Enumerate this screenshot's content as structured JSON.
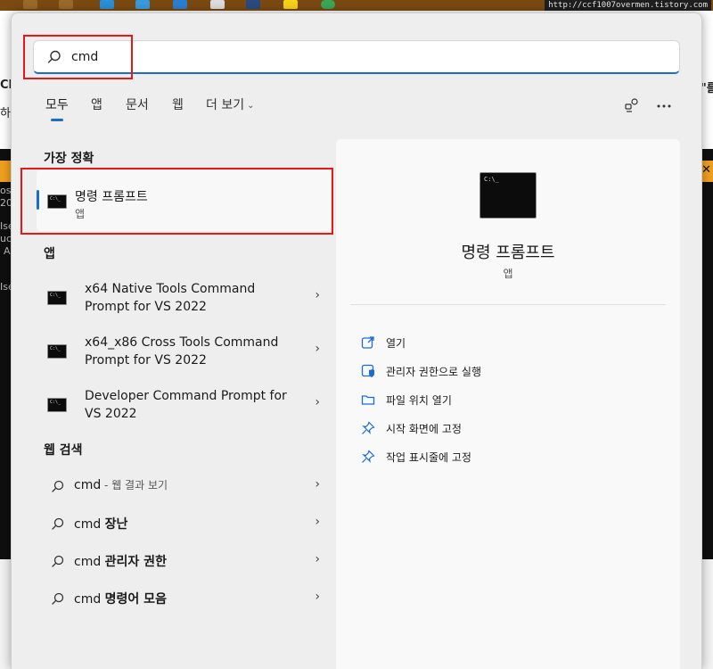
{
  "background": {
    "url_text": "http://ccf1007overmen.tistory.com",
    "left_fragments": [
      "Cl",
      "하.",
      "os",
      "20",
      "Ise",
      "uc",
      "A",
      "Ise"
    ],
    "right_fragments": [
      "\"를"
    ],
    "close_glyph": "✕"
  },
  "search": {
    "value": "cmd",
    "icon": "search-icon"
  },
  "tabs": [
    {
      "label": "모두",
      "active": true
    },
    {
      "label": "앱",
      "active": false
    },
    {
      "label": "문서",
      "active": false
    },
    {
      "label": "웹",
      "active": false
    },
    {
      "label": "더 보기",
      "active": false
    }
  ],
  "more_glyph": "⌄",
  "top_icons": [
    "share-icon",
    "more-options-icon"
  ],
  "best_match": {
    "heading": "가장 정확",
    "title": "명령 프롬프트",
    "subtitle": "앱"
  },
  "apps": {
    "heading": "앱",
    "items": [
      {
        "line1": "x64 Native Tools Command",
        "line2": "Prompt for VS 2022"
      },
      {
        "line1": "x64_x86 Cross Tools Command",
        "line2": "Prompt for VS 2022"
      },
      {
        "line1": "Developer Command Prompt for",
        "line2": "VS 2022"
      }
    ]
  },
  "web_search": {
    "heading": "웹 검색",
    "items": [
      {
        "prefix": "cmd",
        "suffix": " - 웹 결과 보기"
      },
      {
        "prefix": "cmd ",
        "suffix": "장난"
      },
      {
        "prefix": "cmd ",
        "suffix": "관리자 권한"
      },
      {
        "prefix": "cmd ",
        "suffix": "명령어 모음"
      }
    ]
  },
  "chevron": "›",
  "preview": {
    "title": "명령 프롬프트",
    "subtitle": "앱",
    "actions": [
      {
        "label": "열기",
        "icon": "open-icon"
      },
      {
        "label": "관리자 권한으로 실행",
        "icon": "admin-shield-icon"
      },
      {
        "label": "파일 위치 열기",
        "icon": "folder-icon"
      },
      {
        "label": "시작 화면에 고정",
        "icon": "pin-icon"
      },
      {
        "label": "작업 표시줄에 고정",
        "icon": "pin-icon"
      }
    ]
  },
  "colors": {
    "accent": "#1a6dd0",
    "highlight_box": "#e81818",
    "taskbar": "#7a4a12"
  }
}
